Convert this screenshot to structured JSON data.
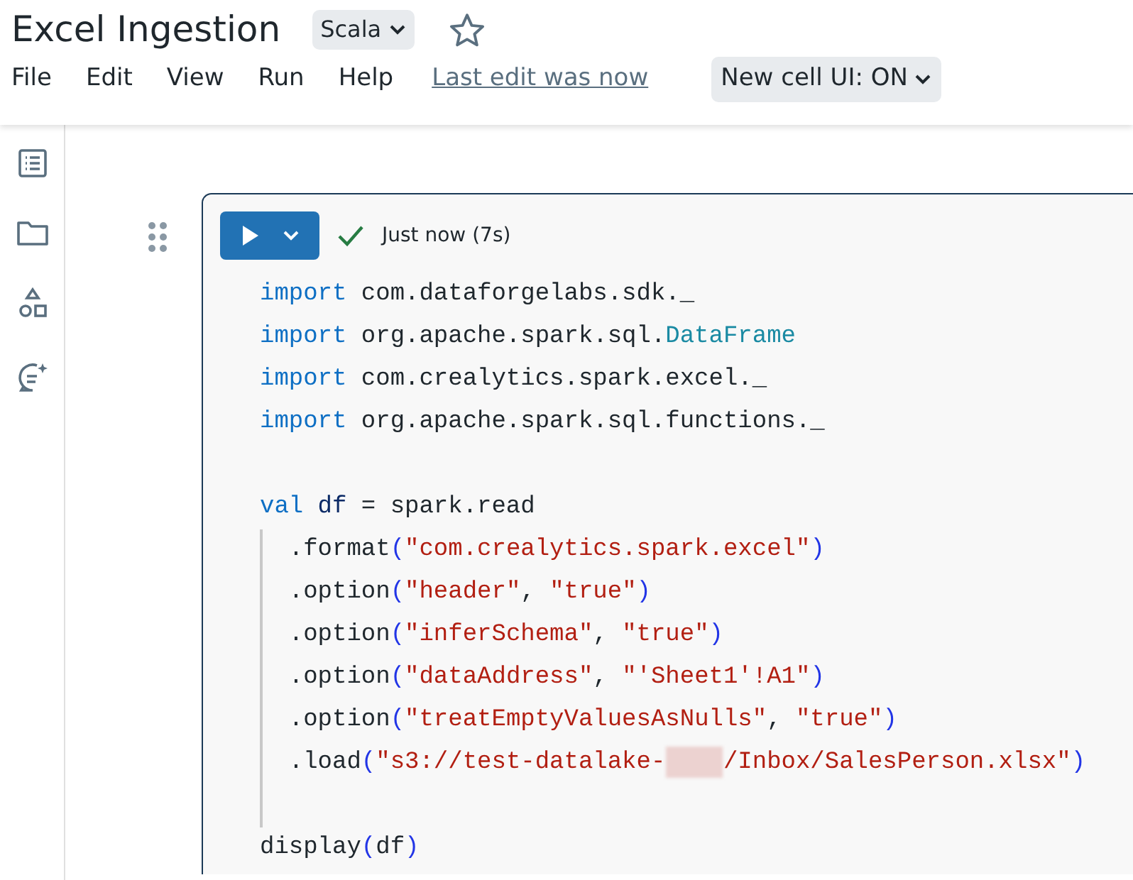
{
  "notebook": {
    "title": "Excel Ingestion",
    "language": "Scala",
    "favorite": false
  },
  "menu": [
    {
      "label": "File"
    },
    {
      "label": "Edit"
    },
    {
      "label": "View"
    },
    {
      "label": "Run"
    },
    {
      "label": "Help"
    }
  ],
  "last_edit": "Last edit was now",
  "cell_ui_toggle": "New cell UI: ON",
  "cell": {
    "status": "Just now (7s)",
    "succeeded": true,
    "lines": [
      {
        "guide": false,
        "tokens": [
          {
            "kind": "kw",
            "text": "import"
          },
          {
            "kind": "plain",
            "text": " com.dataforgelabs.sdk._"
          }
        ]
      },
      {
        "guide": false,
        "tokens": [
          {
            "kind": "kw",
            "text": "import"
          },
          {
            "kind": "plain",
            "text": " org.apache.spark.sql."
          },
          {
            "kind": "type",
            "text": "DataFrame"
          }
        ]
      },
      {
        "guide": false,
        "tokens": [
          {
            "kind": "kw",
            "text": "import"
          },
          {
            "kind": "plain",
            "text": " com.crealytics.spark.excel._"
          }
        ]
      },
      {
        "guide": false,
        "tokens": [
          {
            "kind": "kw",
            "text": "import"
          },
          {
            "kind": "plain",
            "text": " org.apache.spark.sql.functions._"
          }
        ]
      },
      {
        "guide": false
      },
      {
        "guide": false,
        "tokens": [
          {
            "kind": "kw",
            "text": "val"
          },
          {
            "kind": "var",
            "text": " df"
          },
          {
            "kind": "plain",
            "text": " = spark.read"
          }
        ]
      },
      {
        "guide": true,
        "tokens": [
          {
            "kind": "plain",
            "text": "  .format"
          },
          {
            "kind": "paren",
            "text": "("
          },
          {
            "kind": "str",
            "text": "\"com.crealytics.spark.excel\""
          },
          {
            "kind": "paren",
            "text": ")"
          }
        ]
      },
      {
        "guide": true,
        "tokens": [
          {
            "kind": "plain",
            "text": "  .option"
          },
          {
            "kind": "paren",
            "text": "("
          },
          {
            "kind": "str",
            "text": "\"header\""
          },
          {
            "kind": "plain",
            "text": ", "
          },
          {
            "kind": "str",
            "text": "\"true\""
          },
          {
            "kind": "paren",
            "text": ")"
          }
        ]
      },
      {
        "guide": true,
        "tokens": [
          {
            "kind": "plain",
            "text": "  .option"
          },
          {
            "kind": "paren",
            "text": "("
          },
          {
            "kind": "str",
            "text": "\"inferSchema\""
          },
          {
            "kind": "plain",
            "text": ", "
          },
          {
            "kind": "str",
            "text": "\"true\""
          },
          {
            "kind": "paren",
            "text": ")"
          }
        ]
      },
      {
        "guide": true,
        "tokens": [
          {
            "kind": "plain",
            "text": "  .option"
          },
          {
            "kind": "paren",
            "text": "("
          },
          {
            "kind": "str",
            "text": "\"dataAddress\""
          },
          {
            "kind": "plain",
            "text": ", "
          },
          {
            "kind": "str",
            "text": "\"'Sheet1'!A1\""
          },
          {
            "kind": "paren",
            "text": ")"
          }
        ]
      },
      {
        "guide": true,
        "tokens": [
          {
            "kind": "plain",
            "text": "  .option"
          },
          {
            "kind": "paren",
            "text": "("
          },
          {
            "kind": "str",
            "text": "\"treatEmptyValuesAsNulls\""
          },
          {
            "kind": "plain",
            "text": ", "
          },
          {
            "kind": "str",
            "text": "\"true\""
          },
          {
            "kind": "paren",
            "text": ")"
          }
        ]
      },
      {
        "guide": true,
        "tokens": [
          {
            "kind": "plain",
            "text": "  .load"
          },
          {
            "kind": "paren",
            "text": "("
          },
          {
            "kind": "str",
            "text": "\"s3://test-datalake-"
          },
          {
            "kind": "redacted"
          },
          {
            "kind": "str",
            "text": "/Inbox/SalesPerson.xlsx\""
          },
          {
            "kind": "paren",
            "text": ")"
          }
        ]
      },
      {
        "guide": true
      },
      {
        "guide": false,
        "tokens": [
          {
            "kind": "plain",
            "text": "display"
          },
          {
            "kind": "paren",
            "text": "("
          },
          {
            "kind": "plain",
            "text": "df"
          },
          {
            "kind": "paren",
            "text": ")"
          }
        ]
      }
    ]
  }
}
